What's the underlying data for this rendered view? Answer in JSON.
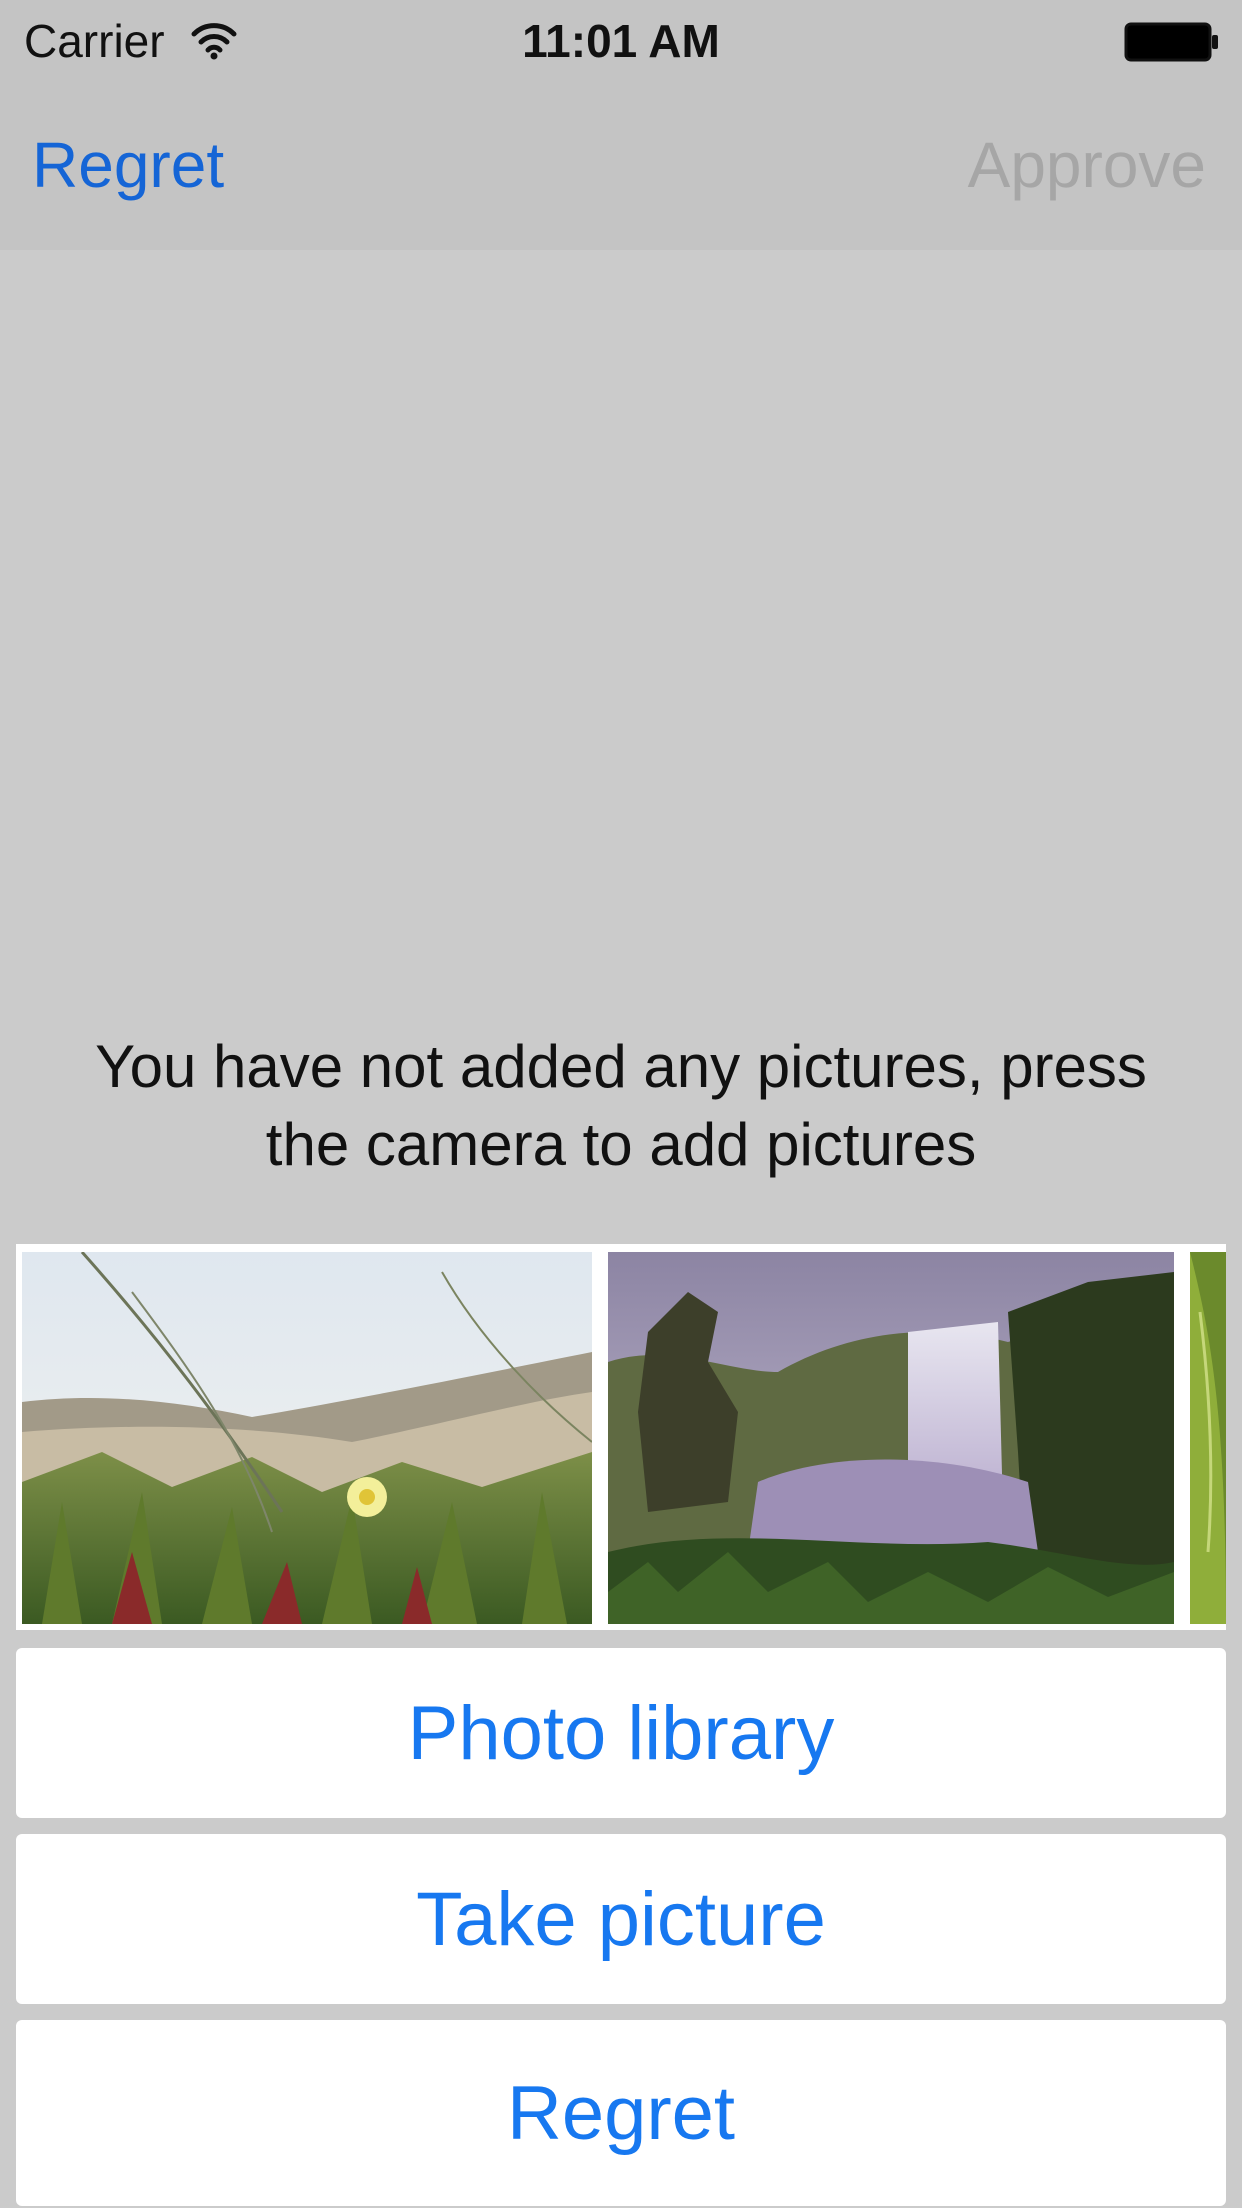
{
  "status_bar": {
    "carrier": "Carrier",
    "time": "11:01 AM",
    "icons": [
      "wifi-icon",
      "battery-icon"
    ]
  },
  "nav": {
    "left_label": "Regret",
    "right_label": "Approve",
    "left_color": "#1565d6",
    "right_color": "#a6a6a6"
  },
  "empty_message": {
    "line1": "You have not added any pictures, press",
    "line2": "the camera to add pictures"
  },
  "photo_strip": {
    "items": [
      "dune-flower-photo",
      "waterfall-photo",
      "leaf-photo"
    ]
  },
  "action_sheet": {
    "library_label": "Photo library",
    "take_label": "Take picture",
    "cancel_label": "Regret",
    "accent_color": "#1778f0"
  }
}
